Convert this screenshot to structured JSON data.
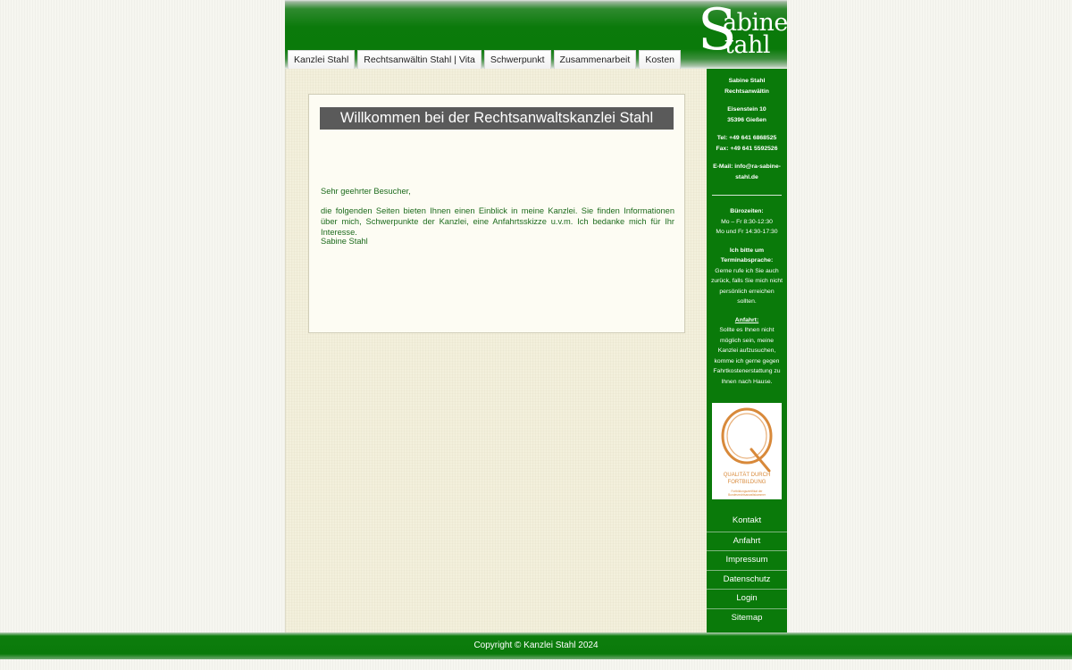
{
  "logo": {
    "big": "S",
    "line1": "abine",
    "line2": "tahl"
  },
  "nav": [
    {
      "label": "Kanzlei Stahl"
    },
    {
      "label": "Rechtsanwältin Stahl | Vita"
    },
    {
      "label": "Schwerpunkt"
    },
    {
      "label": "Zusammenarbeit"
    },
    {
      "label": "Kosten"
    }
  ],
  "main": {
    "title": "Willkommen bei der Rechtsanwaltskanzlei Stahl",
    "greeting": "Sehr geehrter Besucher,",
    "body": "die folgenden Seiten bieten Ihnen einen Einblick in meine Kanzlei. Sie finden Informationen über mich, Schwerpunkte der Kanzlei, eine Anfahrtsskizze u.v.m. Ich bedanke mich für Ihr Interesse.",
    "signature": "Sabine Stahl"
  },
  "sidebar": {
    "name": "Sabine Stahl",
    "profession": "Rechtsanwältin",
    "street": "Eisenstein 10",
    "city": "35396 Gießen",
    "tel": "Tel: +49 641 6868525",
    "fax": "Fax: +49 641 5592526",
    "email": "E-Mail: info@ra-sabine-stahl.de",
    "hours_title": "Bürozeiten:",
    "hours_1": "Mo – Fr 8:30-12:30",
    "hours_2": "Mo und Fr 14:30-17:30",
    "appt_title": "Ich bitte um Terminabsprache:",
    "appt_text": "Gerne rufe ich Sie auch zurück, falls Sie mich nicht persönlich erreichen sollten.",
    "travel_title": "Anfahrt:",
    "travel_text": "Sollte es Ihnen nicht möglich sein, meine Kanzlei aufzusuchen, komme ich gerne gegen Fahrtkostenerstattung zu Ihnen nach Hause.",
    "badge_title_1": "QUALITÄT DURCH",
    "badge_title_2": "FORTBILDUNG",
    "badge_sub_1": "Fortbildungszertifikat der",
    "badge_sub_2": "Bundesrechtsanwaltskammer",
    "menu": [
      {
        "label": "Kontakt"
      },
      {
        "label": "Anfahrt"
      },
      {
        "label": "Impressum"
      },
      {
        "label": "Datenschutz"
      },
      {
        "label": "Login"
      },
      {
        "label": "Sitemap"
      }
    ]
  },
  "footer": {
    "copyright": "Copyright © Kanzlei Stahl 2024"
  },
  "colors": {
    "brand_green": "#0a7a0a",
    "text_green": "#1d6b1d",
    "badge_orange": "#d8893a"
  }
}
